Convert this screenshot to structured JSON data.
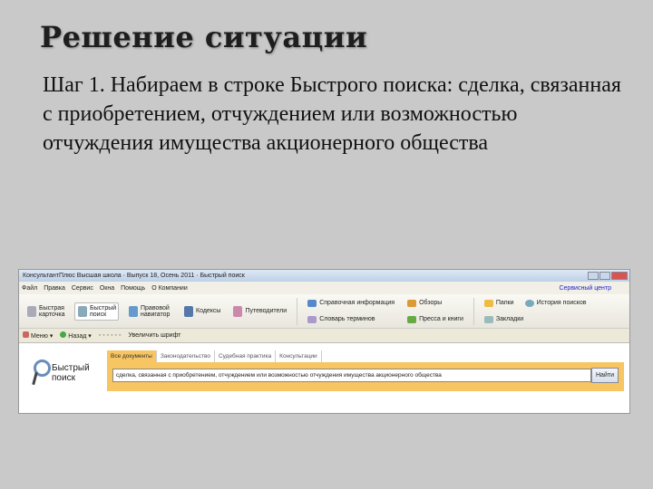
{
  "slide": {
    "title": "Решение ситуации",
    "body": "Шаг 1. Набираем в строке Быстрого поиска: сделка, связанная с приобретением, отчуждением или возможностью отчуждения имущества акционерного общества"
  },
  "app": {
    "window_title": "КонсультантПлюс Высшая школа · Выпуск 18, Осень 2011 · Быстрый поиск",
    "menu": [
      "Файл",
      "Правка",
      "Сервис",
      "Окна",
      "Помощь",
      "О Компании"
    ],
    "service_center": "Сервисный центр",
    "toolbar": [
      "Быстрая карточка",
      "Быстрый поиск",
      "Правовой навигатор",
      "Кодексы",
      "Путеводители",
      "Справочная информация",
      "Обзоры",
      "Словарь терминов",
      "Пресса и книги",
      "Папки",
      "История поисков",
      "Закладки"
    ],
    "toolbar2": [
      "Меню",
      "Назад",
      "Увеличить шрифт"
    ],
    "search": {
      "logo": "Быстрый поиск",
      "tabs": [
        "Все документы",
        "Законодательство",
        "Судебная практика",
        "Консультации"
      ],
      "query": "сделка, связанная с приобретением, отчуждением или возможностью отчуждения имущества акционерного общества",
      "find_button": "Найти"
    }
  }
}
